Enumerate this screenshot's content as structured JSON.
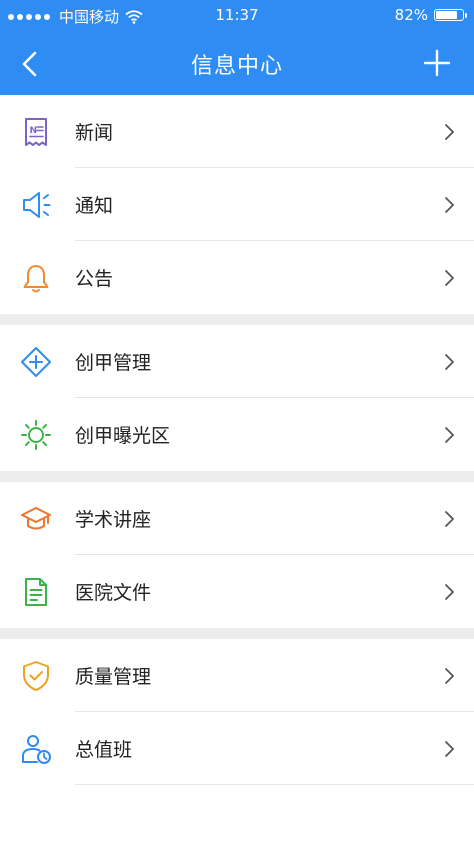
{
  "status_bar": {
    "carrier": "中国移动",
    "time": "11:37",
    "battery": "82%",
    "battery_level": 0.82
  },
  "nav": {
    "title": "信息中心",
    "back_icon": "chevron-left-icon",
    "add_icon": "plus-icon"
  },
  "colors": {
    "header": "#2f8cf2",
    "news": "#7b63c9",
    "notice": "#2f8cf2",
    "bulletin": "#f08c2e",
    "accreditation": "#2f8cf2",
    "exposure": "#3cb34a",
    "lecture": "#f0742e",
    "documents": "#3cb34a",
    "quality": "#f0a21e",
    "duty": "#2f8cf2"
  },
  "groups": [
    {
      "items": [
        {
          "label": "新闻",
          "icon": "news-icon"
        },
        {
          "label": "通知",
          "icon": "speaker-icon"
        },
        {
          "label": "公告",
          "icon": "bell-icon"
        }
      ]
    },
    {
      "items": [
        {
          "label": "创甲管理",
          "icon": "plus-diamond-icon"
        },
        {
          "label": "创甲曝光区",
          "icon": "sun-icon"
        }
      ]
    },
    {
      "items": [
        {
          "label": "学术讲座",
          "icon": "graduation-cap-icon"
        },
        {
          "label": "医院文件",
          "icon": "document-icon"
        }
      ]
    },
    {
      "items": [
        {
          "label": "质量管理",
          "icon": "shield-check-icon"
        },
        {
          "label": "总值班",
          "icon": "user-clock-icon"
        }
      ]
    }
  ]
}
